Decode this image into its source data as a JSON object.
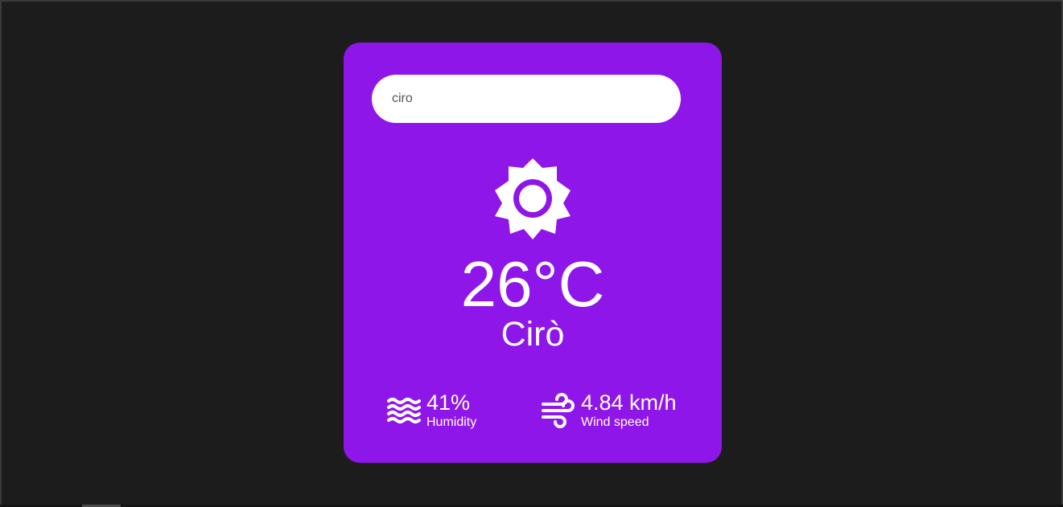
{
  "search": {
    "value": "ciro"
  },
  "weather": {
    "icon": "sun-icon",
    "temperature": "26°C",
    "city": "Cirò"
  },
  "details": {
    "humidity": {
      "icon": "waves-icon",
      "value": "41%",
      "label": "Humidity"
    },
    "wind": {
      "icon": "wind-icon",
      "value": "4.84 km/h",
      "label": "Wind speed"
    }
  },
  "colors": {
    "background": "#1c1c1c",
    "card": "#8f16e8",
    "text": "#ffffff"
  }
}
